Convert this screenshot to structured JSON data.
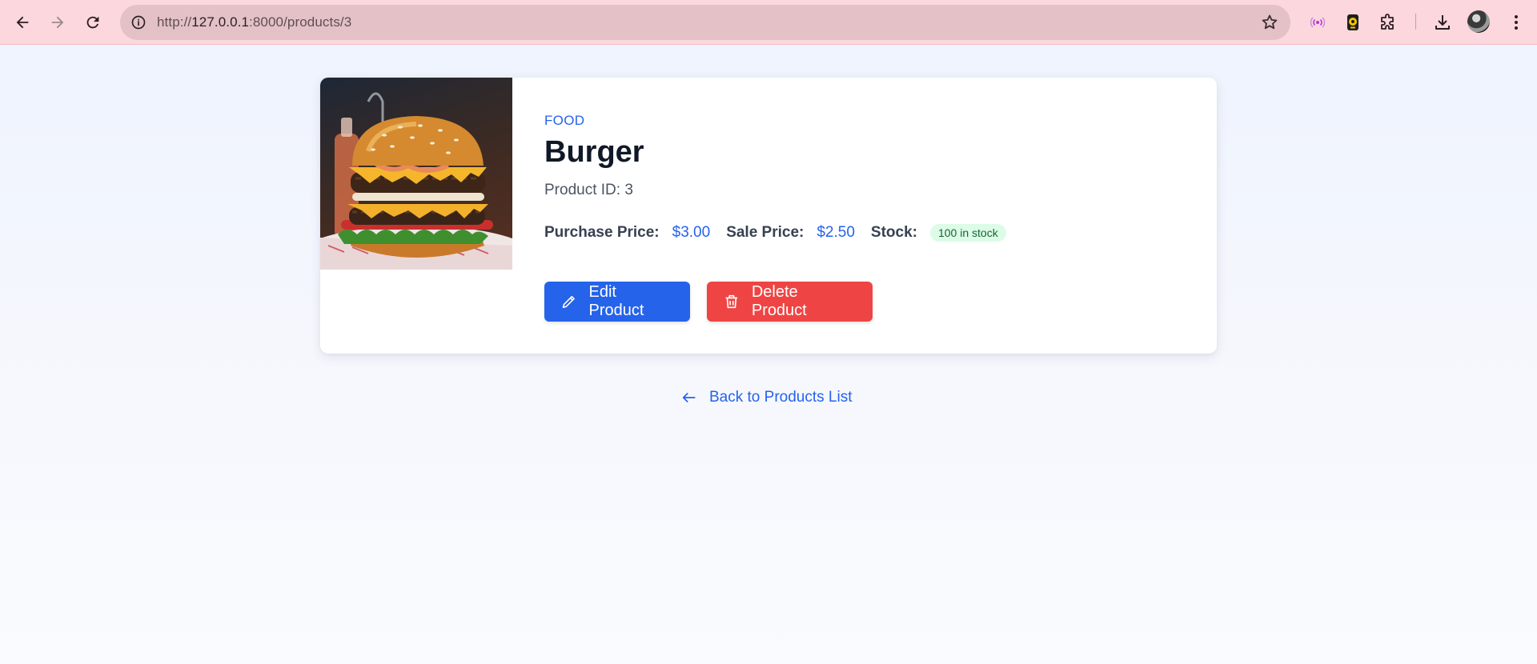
{
  "browser": {
    "url_scheme": "http://",
    "url_host": "127.0.0.1",
    "url_path": ":8000/products/3",
    "icons": [
      "back-icon",
      "forward-icon",
      "reload-icon",
      "info-icon",
      "star-icon",
      "extension-broadcast-icon",
      "extension-yellow-icon",
      "extensions-puzzle-icon",
      "download-icon",
      "profile-avatar",
      "menu-kebab-icon"
    ]
  },
  "product": {
    "category": "FOOD",
    "name": "Burger",
    "id_label": "Product ID: 3",
    "purchase_price_label": "Purchase Price:",
    "purchase_price": "$3.00",
    "sale_price_label": "Sale Price:",
    "sale_price": "$2.50",
    "stock_label": "Stock:",
    "stock_badge": "100 in stock",
    "image": "burger-image"
  },
  "actions": {
    "edit_label": "Edit Product",
    "delete_label": "Delete Product"
  },
  "back_link": {
    "label": "Back to Products List"
  },
  "colors": {
    "accent": "#2563eb",
    "danger": "#ef4444",
    "stock_badge_bg": "#dcfce7",
    "stock_badge_text": "#166534",
    "chrome_bg": "#fcd7dd"
  }
}
